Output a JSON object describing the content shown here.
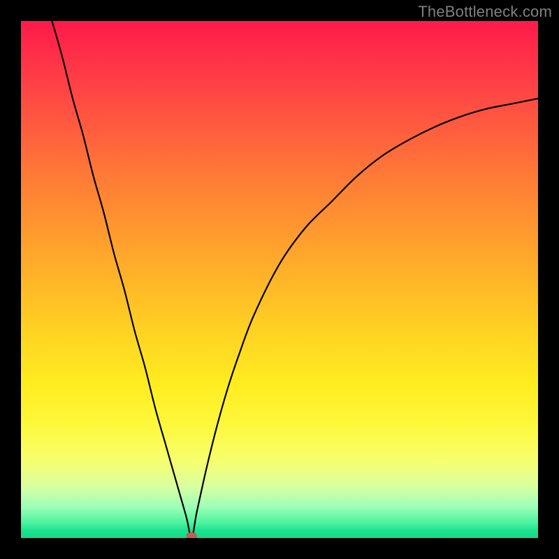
{
  "watermark": "TheBottleneck.com",
  "chart_data": {
    "type": "line",
    "title": "",
    "xlabel": "",
    "ylabel": "",
    "xlim": [
      0,
      100
    ],
    "ylim": [
      0,
      100
    ],
    "grid": false,
    "legend": false,
    "annotations": [],
    "minimum_marker": {
      "x": 33,
      "y": 0,
      "color": "#cc5a50"
    },
    "series": [
      {
        "name": "bottleneck-curve",
        "color": "#000000",
        "x": [
          6,
          8,
          10,
          12,
          14,
          16,
          18,
          20,
          22,
          24,
          26,
          28,
          30,
          32,
          33,
          34,
          36,
          38,
          40,
          42,
          45,
          50,
          55,
          60,
          65,
          70,
          75,
          80,
          85,
          90,
          95,
          100
        ],
        "y": [
          100,
          93,
          85,
          78,
          70,
          63,
          55,
          48,
          40,
          33,
          25,
          18,
          11,
          4,
          0,
          5,
          14,
          22,
          29,
          35,
          43,
          53,
          60,
          65,
          70,
          74,
          77,
          79.5,
          81.5,
          83,
          84,
          85
        ]
      }
    ],
    "background_gradient": {
      "direction": "vertical",
      "stops": [
        {
          "pos": 0.0,
          "color": "#ff1a4b"
        },
        {
          "pos": 0.5,
          "color": "#ffb528"
        },
        {
          "pos": 0.78,
          "color": "#fdf83a"
        },
        {
          "pos": 1.0,
          "color": "#14d987"
        }
      ]
    }
  }
}
